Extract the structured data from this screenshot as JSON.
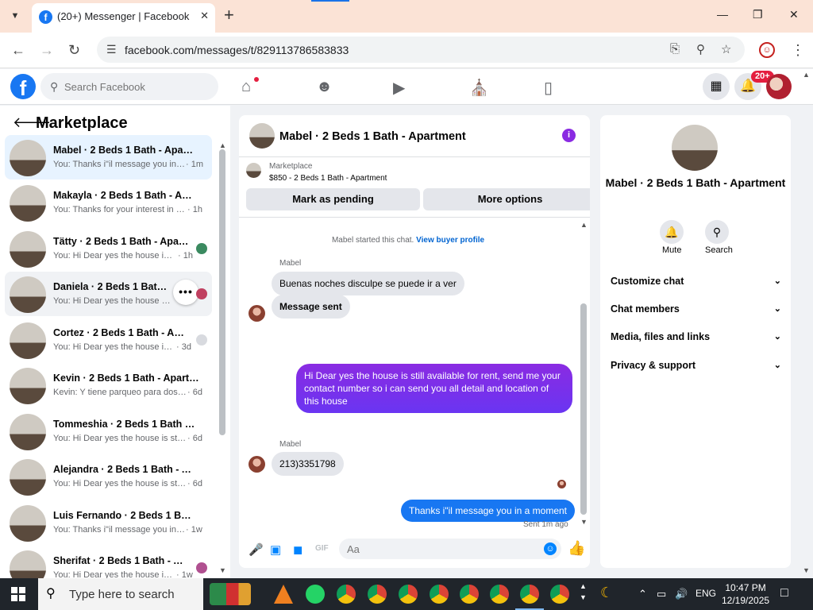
{
  "browser": {
    "tab_title": "(20+) Messenger | Facebook",
    "url": "facebook.com/messages/t/829113786583833"
  },
  "fb": {
    "search_placeholder": "Search Facebook",
    "notif_badge": "20+"
  },
  "left": {
    "title": "Marketplace",
    "conversations": [
      {
        "name": "Mabel · 2 Beds 1 Bath - Apartm...",
        "snippet": "You: Thanks i\"il message you in a ...",
        "time": "· 1m"
      },
      {
        "name": "Makayla · 2 Beds 1 Bath - Apart...",
        "snippet": "You: Thanks for your interest in the...",
        "time": "· 1h"
      },
      {
        "name": "Tätty · 2 Beds 1 Bath - Apartm...",
        "snippet": "You: Hi Dear yes the house is sti...",
        "time": "· 1h"
      },
      {
        "name": "Daniela · 2 Beds 1 Bath - Apart...",
        "snippet": "You: Hi Dear yes the house is sti...",
        "time": ""
      },
      {
        "name": "Cortez · 2 Beds 1 Bath - Apart...",
        "snippet": "You: Hi Dear yes the house is sti...",
        "time": "· 3d"
      },
      {
        "name": "Kevin · 2 Beds 1 Bath - Apartment",
        "snippet": "Kevin: Y tiene parqueo para dos ve...",
        "time": "· 6d"
      },
      {
        "name": "Tommeshia · 2 Beds 1 Bath - Ap...",
        "snippet": "You: Hi Dear yes the house is still a...",
        "time": "· 6d"
      },
      {
        "name": "Alejandra · 2 Beds 1 Bath - Apar...",
        "snippet": "You: Hi Dear yes the house is still a...",
        "time": "· 6d"
      },
      {
        "name": "Luis Fernando · 2 Beds 1 Bath - ...",
        "snippet": "You: Thanks i\"il message you in a ...",
        "time": "· 1w"
      },
      {
        "name": "Sherifat · 2 Beds 1 Bath - Apa...",
        "snippet": "You: Hi Dear yes the house is sti...",
        "time": "· 1w"
      }
    ]
  },
  "chat": {
    "title": "Mabel · 2 Beds 1 Bath - Apartment",
    "listing_label": "Marketplace",
    "listing_detail": "$850 - 2 Beds 1 Bath - Apartment",
    "btn_pending": "Mark as pending",
    "btn_more": "More options",
    "started_note": "Mabel started this chat.",
    "view_profile": "View buyer profile",
    "sender_name": "Mabel",
    "msg_in_1": "Buenas noches disculpe se puede ir a ver",
    "msg_in_2": "Message sent",
    "msg_out_1": "Hi Dear yes the house is still available for rent, send me your contact number so i can send you all detail and location of this house",
    "sender_name_2": "Mabel",
    "msg_in_3": "213)3351798",
    "msg_out_2": "Thanks i\"il message you in a moment",
    "sent_note": "Sent 1m ago",
    "composer_placeholder": "Aa"
  },
  "info": {
    "title": "Mabel · 2 Beds 1 Bath - Apartment",
    "mute": "Mute",
    "search": "Search",
    "rows": [
      "Customize chat",
      "Chat members",
      "Media, files and links",
      "Privacy & support"
    ]
  },
  "taskbar": {
    "search_text": "Type here to search",
    "lang": "ENG",
    "time": "10:47 PM",
    "date": "12/19/2025"
  }
}
